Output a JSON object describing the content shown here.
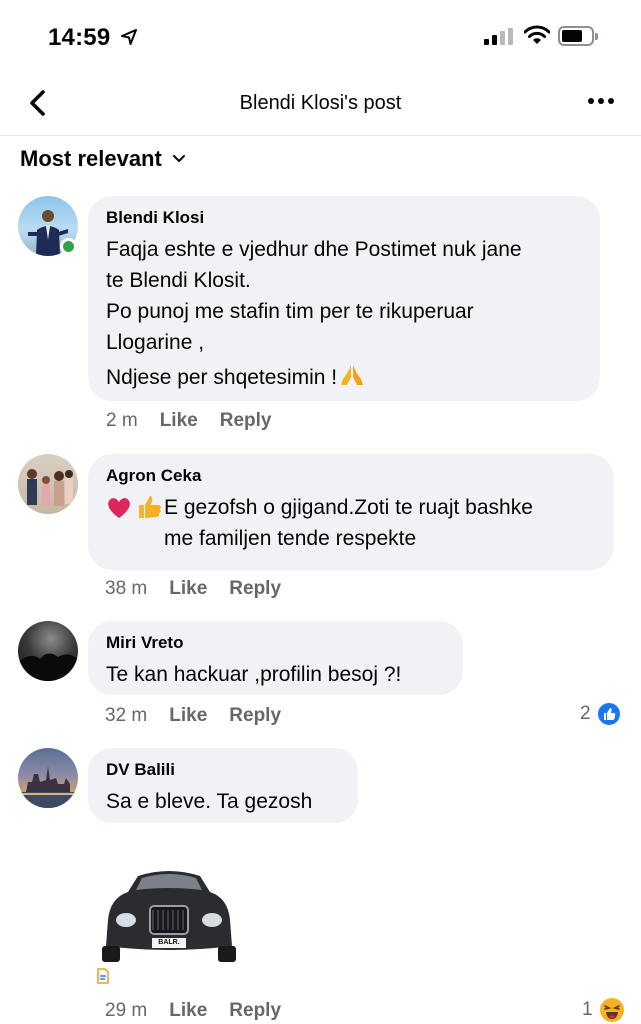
{
  "status_bar": {
    "time": "14:59"
  },
  "header": {
    "title": "Blendi Klosi's post"
  },
  "sort": {
    "label": "Most relevant"
  },
  "comments": [
    {
      "author": "Blendi Klosi",
      "text": "Faqja eshte e vjedhur dhe Postimet nuk jane\nte Blendi Klosit.\nPo punoj me stafin tim per te rikuperuar\nLlogarine ,",
      "text2": "Ndjese per shqetesimin !",
      "time": "2 m",
      "like": "Like",
      "reply": "Reply"
    },
    {
      "author": "Agron Ceka",
      "text": "E gezofsh o gjigand.Zoti te ruajt bashke\nme familjen tende respekte",
      "time": "38 m",
      "like": "Like",
      "reply": "Reply"
    },
    {
      "author": "Miri Vreto",
      "text": "Te kan hackuar ,profilin besoj ?!",
      "time": "32 m",
      "like": "Like",
      "reply": "Reply",
      "reaction_count": "2"
    },
    {
      "author": "DV Balili",
      "text": "Sa e bleve. Ta gezosh",
      "time": "29 m",
      "like": "Like",
      "reply": "Reply",
      "reaction_count": "1",
      "plate_text": "BALR."
    }
  ],
  "icons": {
    "status": [
      "location-arrow-icon",
      "signal-icon",
      "wifi-icon",
      "battery-icon"
    ],
    "header": [
      "back-chevron-icon",
      "more-dots-icon"
    ],
    "sort": "chevron-down-icon",
    "reactions": [
      "like-reaction-icon",
      "haha-reaction-icon"
    ],
    "emoji": [
      "praying-hands-emoji",
      "red-heart-emoji",
      "thumbs-up-emoji"
    ]
  },
  "colors": {
    "bubble": "#f0f2f5",
    "online": "#31a24c",
    "like_blue": "#1877f2",
    "secondary_text": "#65676b",
    "haha_yellow": "#f7b125"
  }
}
